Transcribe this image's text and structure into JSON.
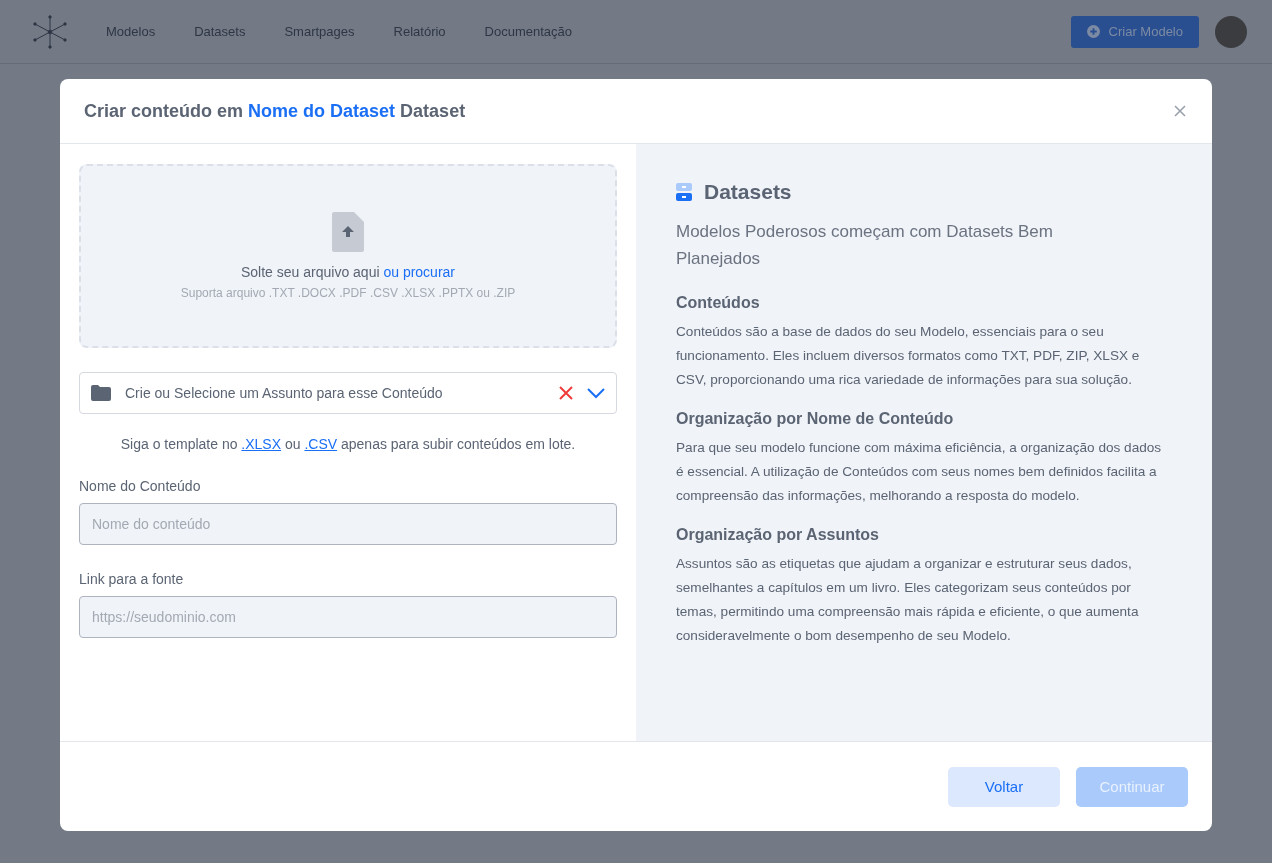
{
  "navbar": {
    "links": [
      "Modelos",
      "Datasets",
      "Smartpages",
      "Relatório",
      "Documentação"
    ],
    "create_button": "Criar Modelo"
  },
  "modal": {
    "title": {
      "prefix": "Criar conteúdo em",
      "highlight": "Nome do Dataset",
      "suffix": "Dataset"
    },
    "dropzone": {
      "text": "Solte seu arquivo aqui",
      "link": "ou procurar",
      "formats": "Suporta arquivo .TXT .DOCX .PDF .CSV .XLSX .PPTX ou .ZIP"
    },
    "subject_select": {
      "placeholder": "Crie ou Selecione um Assunto para esse Conteúdo"
    },
    "template_hint": [
      {
        "kind": "text",
        "text": "Siga o template no "
      },
      {
        "kind": "link",
        "text": ".XLSX"
      },
      {
        "kind": "text",
        "text": " ou "
      },
      {
        "kind": "link",
        "text": ".CSV"
      },
      {
        "kind": "text",
        "text": " apenas para subir conteúdos em lote."
      }
    ],
    "fields": [
      {
        "label": "Nome do Conteúdo",
        "placeholder": "Nome do conteúdo"
      },
      {
        "label": "Link para a fonte",
        "placeholder": "https://seudominio.com"
      }
    ],
    "info": {
      "title": "Datasets",
      "subtitle": "Modelos Poderosos começam com Datasets Bem Planejados",
      "sections": [
        {
          "heading": "Conteúdos",
          "text": "Conteúdos são a base de dados do seu Modelo, essenciais para o seu funcionamento. Eles incluem diversos formatos como TXT, PDF, ZIP, XLSX e CSV, proporcionando uma rica variedade de informações para sua solução."
        },
        {
          "heading": "Organização por Nome de Conteúdo",
          "text": "Para que seu modelo funcione com máxima eficiência, a organização dos dados é essencial. A utilização de Conteúdos com seus nomes bem definidos facilita a compreensão das informações, melhorando a resposta do modelo."
        },
        {
          "heading": "Organização por Assuntos",
          "text": "Assuntos são as etiquetas que ajudam a organizar e estruturar seus dados, semelhantes a capítulos em um livro. Eles categorizam seus conteúdos por temas, permitindo uma compreensão mais rápida e eficiente, o que aumenta consideravelmente o bom desempenho de seu Modelo."
        }
      ]
    },
    "buttons": [
      {
        "label": "Voltar",
        "kind": "secondary",
        "disabled": false
      },
      {
        "label": "Continuar",
        "kind": "primary",
        "disabled": true
      }
    ]
  }
}
